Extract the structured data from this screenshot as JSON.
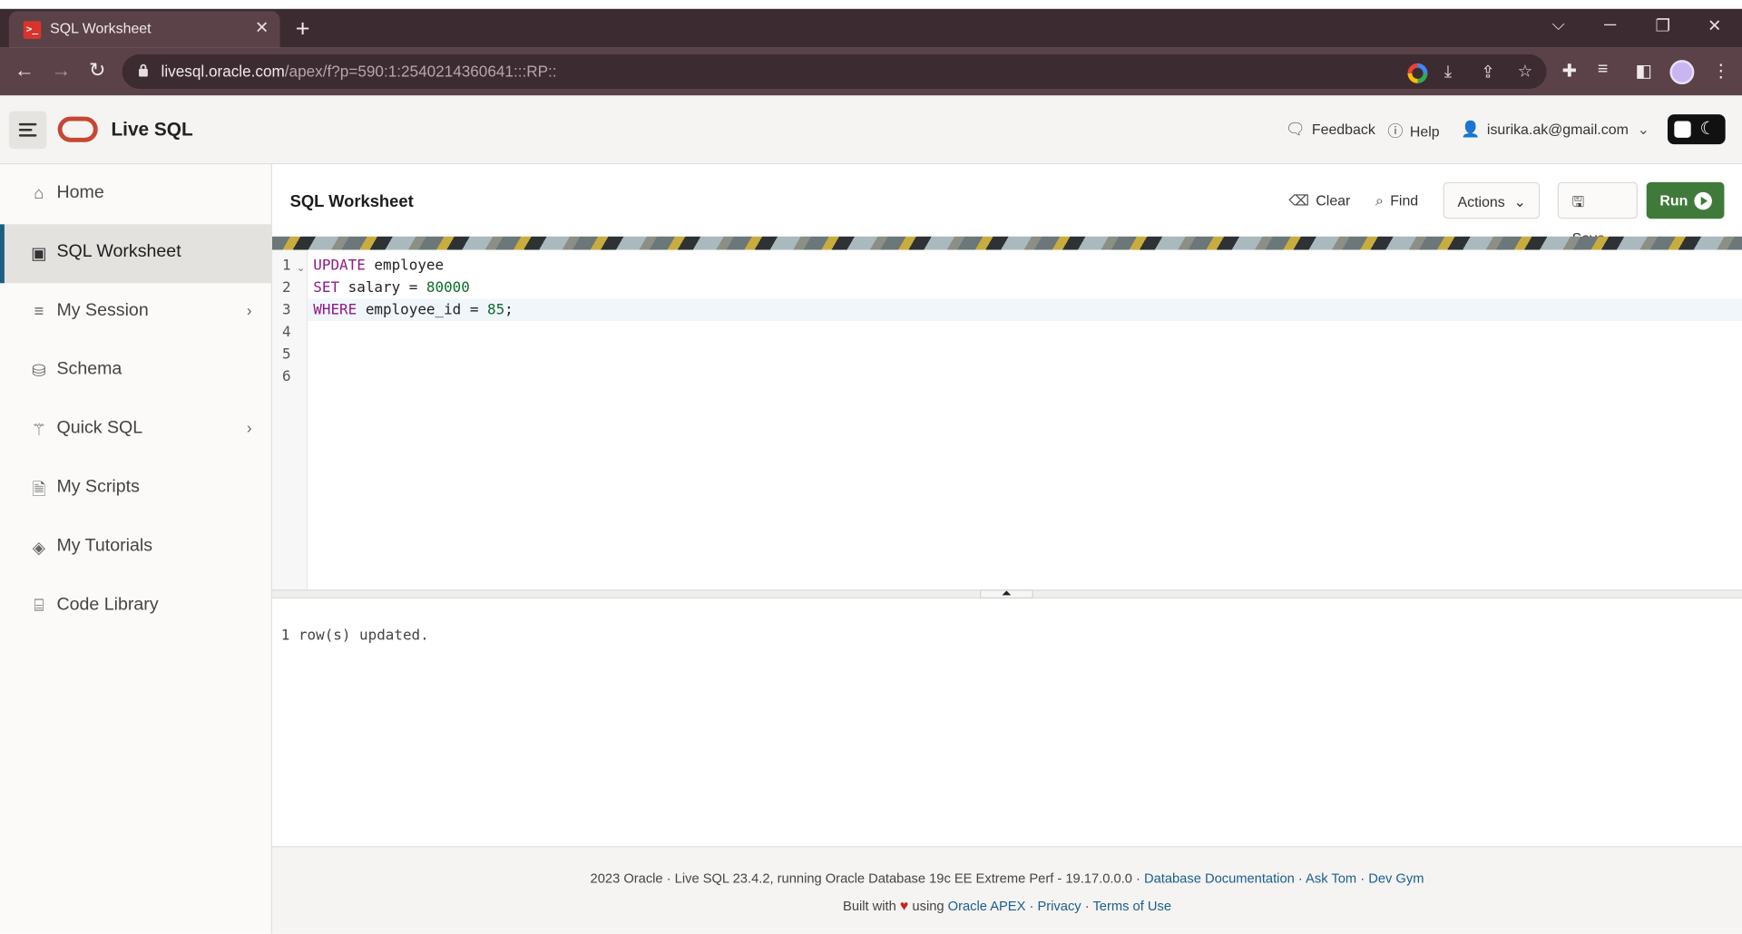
{
  "browser": {
    "tab_title": "SQL Worksheet",
    "tab_favicon": ">_",
    "new_tab": "+",
    "url_host": "livesql.oracle.com",
    "url_path": "/apex/f?p=590:1:2540214360641:::RP::"
  },
  "app": {
    "title": "Live SQL",
    "feedback": "Feedback",
    "help": "Help",
    "user": "isurika.ak@gmail.com"
  },
  "sidebar": {
    "items": [
      {
        "label": "Home",
        "icon": "home-icon"
      },
      {
        "label": "SQL Worksheet",
        "icon": "terminal-icon",
        "active": true
      },
      {
        "label": "My Session",
        "icon": "list-icon",
        "has_children": true
      },
      {
        "label": "Schema",
        "icon": "database-icon"
      },
      {
        "label": "Quick SQL",
        "icon": "magic-wand-icon",
        "has_children": true
      },
      {
        "label": "My Scripts",
        "icon": "document-icon"
      },
      {
        "label": "My Tutorials",
        "icon": "graduation-cap-icon"
      },
      {
        "label": "Code Library",
        "icon": "library-icon"
      }
    ]
  },
  "worksheet": {
    "title": "SQL Worksheet",
    "clear": "Clear",
    "find": "Find",
    "actions": "Actions",
    "save": "Save",
    "run": "Run",
    "line_numbers": [
      "1",
      "2",
      "3",
      "4",
      "5",
      "6"
    ],
    "code": {
      "l1_kw": "UPDATE",
      "l1_rest": " employee",
      "l2_kw": "SET",
      "l2_mid": " salary = ",
      "l2_num": "80000",
      "l3_kw": "WHERE",
      "l3_mid": " employee_id = ",
      "l3_num": "85",
      "l3_end": ";"
    },
    "output": "1 row(s) updated."
  },
  "footer": {
    "line1_text": "2023 Oracle · Live SQL 23.4.2, running Oracle Database 19c EE Extreme Perf - 19.17.0.0.0 · ",
    "database_documentation": "Database Documentation",
    "sep": " · ",
    "ask_tom": "Ask Tom",
    "dev_gym": "Dev Gym",
    "built_with": "Built with ",
    "using": " using ",
    "oracle_apex": "Oracle APEX",
    "privacy": "Privacy",
    "terms": "Terms of Use"
  },
  "colors": {
    "run_button": "#3f7a3a",
    "active_nav_accent": "#1c5f82",
    "oracle_logo": "#c74634",
    "browser_chrome": "#3c2c31"
  }
}
